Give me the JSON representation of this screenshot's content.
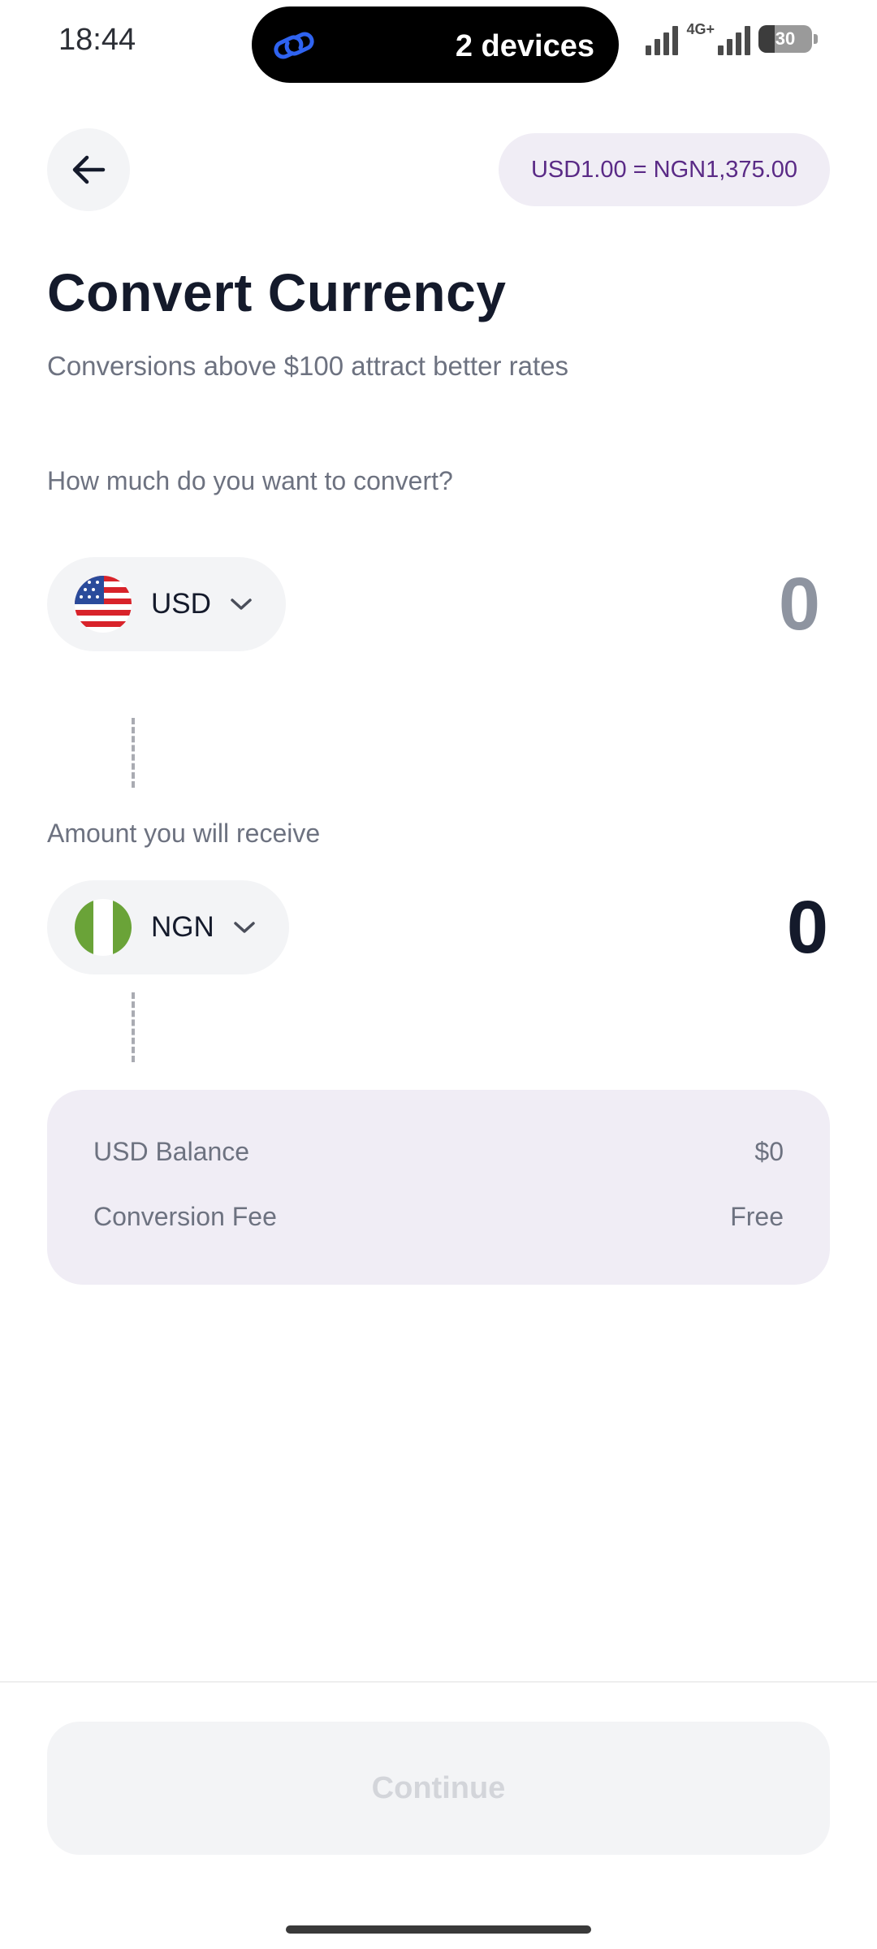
{
  "status_bar": {
    "time": "18:44",
    "island_text": "2 devices",
    "network": "4G+",
    "battery": "30",
    "battery_level_pct": 30
  },
  "header": {
    "back_icon": "arrow-left-icon",
    "rate": "USD1.00 = NGN1,375.00"
  },
  "page": {
    "title": "Convert Currency",
    "subtitle": "Conversions above $100 attract better rates"
  },
  "from": {
    "label": "How much do you want to convert?",
    "currency": "USD",
    "amount": "0",
    "flag_icon": "us-flag-icon"
  },
  "to": {
    "label": "Amount you will receive",
    "currency": "NGN",
    "amount": "0",
    "flag_icon": "nigeria-flag-icon"
  },
  "summary": {
    "balance_label": "USD Balance",
    "balance_value": "$0",
    "fee_label": "Conversion Fee",
    "fee_value": "Free"
  },
  "footer": {
    "continue_label": "Continue"
  },
  "colors": {
    "accent_text": "#5a2a86",
    "pill_bg": "#f0edf5",
    "primary_text": "#141a2b",
    "muted_text": "#6d7280"
  }
}
